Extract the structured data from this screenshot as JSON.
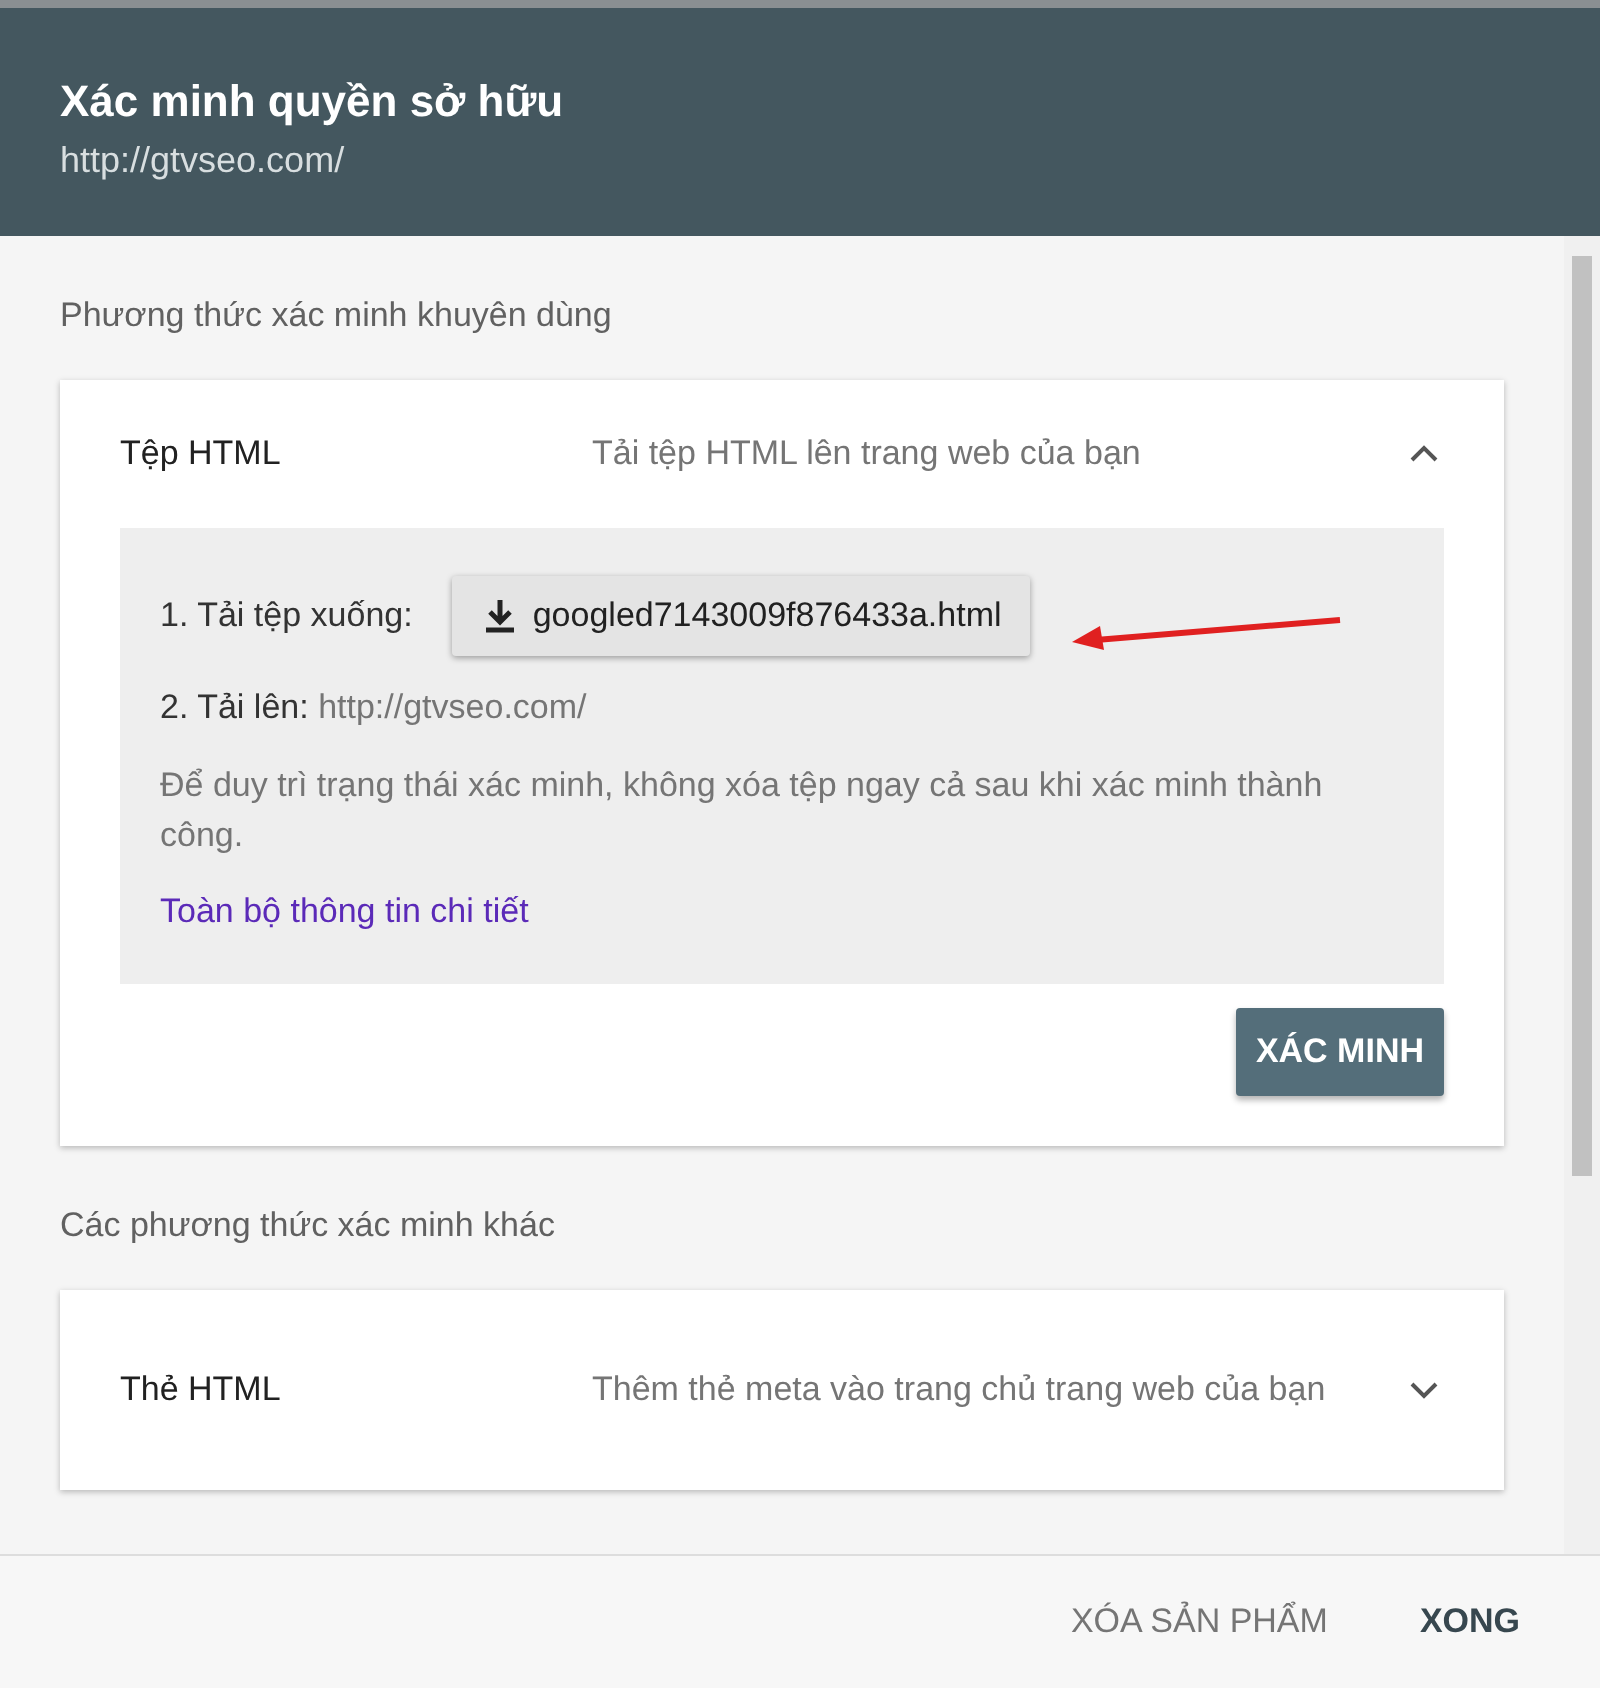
{
  "dialog": {
    "title": "Xác minh quyền sở hữu",
    "url": "http://gtvseo.com/"
  },
  "recommended": {
    "heading": "Phương thức xác minh khuyên dùng",
    "methods": [
      {
        "name": "Tệp HTML",
        "description": "Tải tệp HTML lên trang web của bạn",
        "expanded": true,
        "step_1_label": "1. Tải tệp xuống:",
        "download_file": "googled7143009f876433a.html",
        "step_2_label": "2. Tải lên:",
        "step_2_url": "http://gtvseo.com/",
        "note": "Để duy trì trạng thái xác minh, không xóa tệp ngay cả sau khi xác minh thành công.",
        "details_link": "Toàn bộ thông tin chi tiết",
        "verify_button": "XÁC MINH"
      }
    ]
  },
  "other": {
    "heading": "Các phương thức xác minh khác",
    "methods": [
      {
        "name": "Thẻ HTML",
        "description": "Thêm thẻ meta vào trang chủ trang web của bạn",
        "expanded": false
      }
    ]
  },
  "footer": {
    "buttons": [
      {
        "label": "XÓA SẢN PHẨM",
        "kind": "secondary"
      },
      {
        "label": "XONG",
        "kind": "primary"
      }
    ]
  }
}
